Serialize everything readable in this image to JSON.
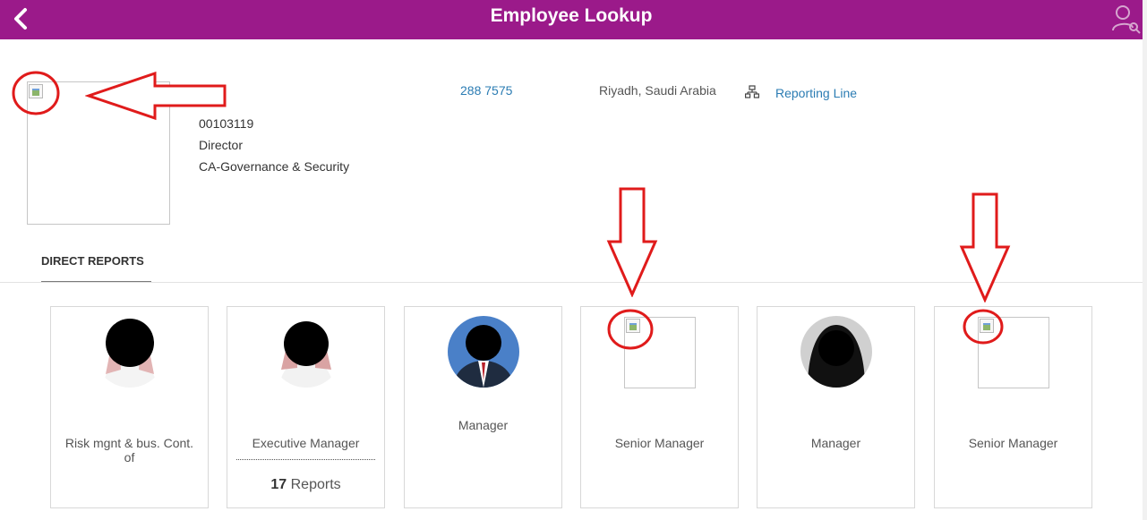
{
  "header": {
    "title": "Employee Lookup",
    "color": "#9b1a8a"
  },
  "employee": {
    "id": "00103119",
    "position": "Director",
    "department": "CA-Governance & Security",
    "phone": "288 7575",
    "location": "Riyadh, Saudi Arabia",
    "reporting_line_label": "Reporting Line"
  },
  "tabs": {
    "direct_reports": "DIRECT REPORTS"
  },
  "direct_reports": [
    {
      "title": "Risk mgnt & bus. Cont. of"
    },
    {
      "title": "Executive Manager",
      "reports_count": "17",
      "reports_label": "Reports"
    },
    {
      "title": "Manager"
    },
    {
      "title": "Senior Manager"
    },
    {
      "title": "Manager"
    },
    {
      "title": "Senior Manager"
    }
  ],
  "icons": {
    "back": "chevron-left-icon",
    "user_search": "user-search-icon",
    "reporting_line": "org-chart-icon"
  },
  "annotation_color": "#e01b1b"
}
